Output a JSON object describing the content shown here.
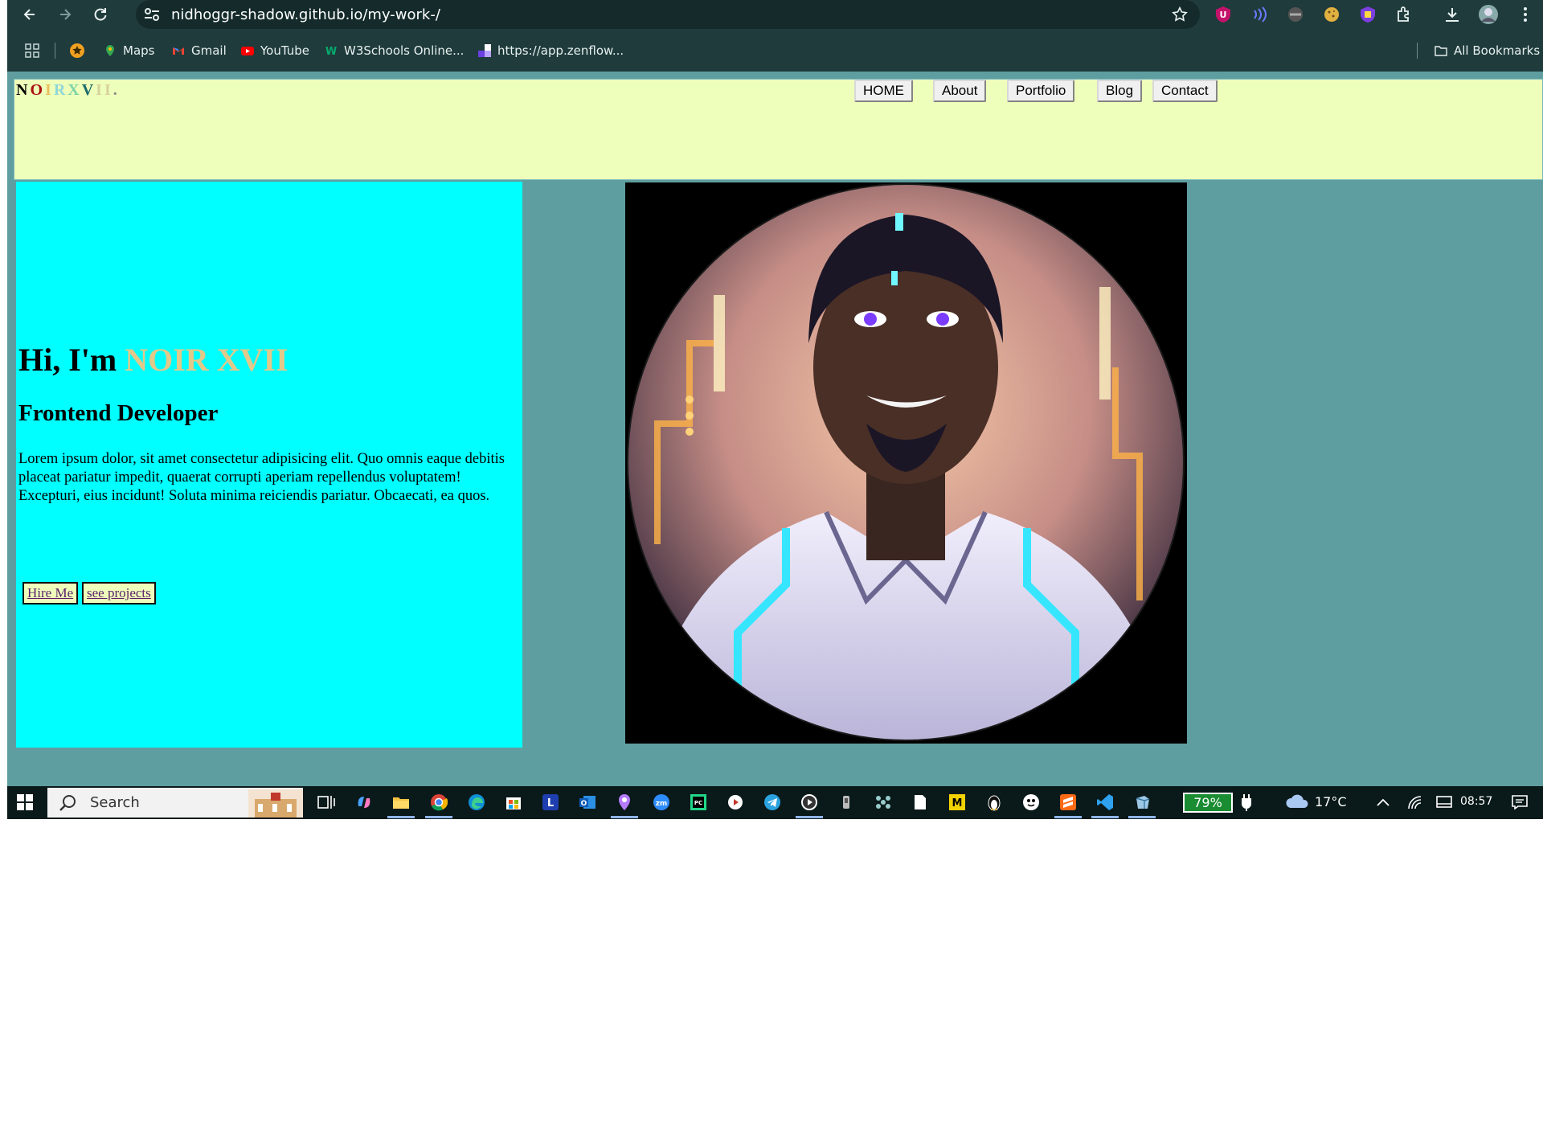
{
  "browser": {
    "url": "nidhoggr-shadow.github.io/my-work-/",
    "bookmarks": [
      {
        "label": "Maps",
        "icon": "maps-pin-icon"
      },
      {
        "label": "Gmail",
        "icon": "gmail-icon"
      },
      {
        "label": "YouTube",
        "icon": "youtube-icon"
      },
      {
        "label": "W3Schools Online...",
        "icon": "w3schools-icon"
      },
      {
        "label": "https://app.zenflow...",
        "icon": "zenflow-icon"
      }
    ],
    "all_bookmarks": "All Bookmarks"
  },
  "site": {
    "logo_letters": [
      {
        "char": "N",
        "color": "#000000"
      },
      {
        "char": "O",
        "color": "#aa1111"
      },
      {
        "char": "I",
        "color": "#e8c060"
      },
      {
        "char": "R",
        "color": "#8fd8d8"
      },
      {
        "char": "X",
        "color": "#7fd4a8"
      },
      {
        "char": "V",
        "color": "#1b6b6b"
      },
      {
        "char": "I",
        "color": "#d8d29a"
      },
      {
        "char": "I",
        "color": "#d8d29a"
      },
      {
        "char": ".",
        "color": "#888888"
      }
    ],
    "nav": [
      "HOME",
      "About",
      "Portfolio",
      "Blog",
      "Contact"
    ],
    "hero": {
      "greeting_prefix": "Hi, I'm ",
      "name": "NOIR XVII",
      "role": "Frontend Developer",
      "description": "Lorem ipsum dolor, sit amet consectetur adipisicing elit. Quo omnis eaque debitis placeat pariatur impedit, quaerat corrupti aperiam repellendus voluptatem! Excepturi, eius incidunt! Soluta minima reiciendis pariatur. Obcaecati, ea quos.",
      "hire_label": "Hire Me",
      "projects_label": "see projects"
    },
    "colors": {
      "header_bg": "#eeffbb",
      "hero_bg": "#00ffff",
      "page_bg": "#5f9ea0",
      "name_color": "#e2c98a"
    }
  },
  "taskbar": {
    "search_label": "Search",
    "battery": "79%",
    "temperature": "17°C",
    "time": "08:57"
  }
}
